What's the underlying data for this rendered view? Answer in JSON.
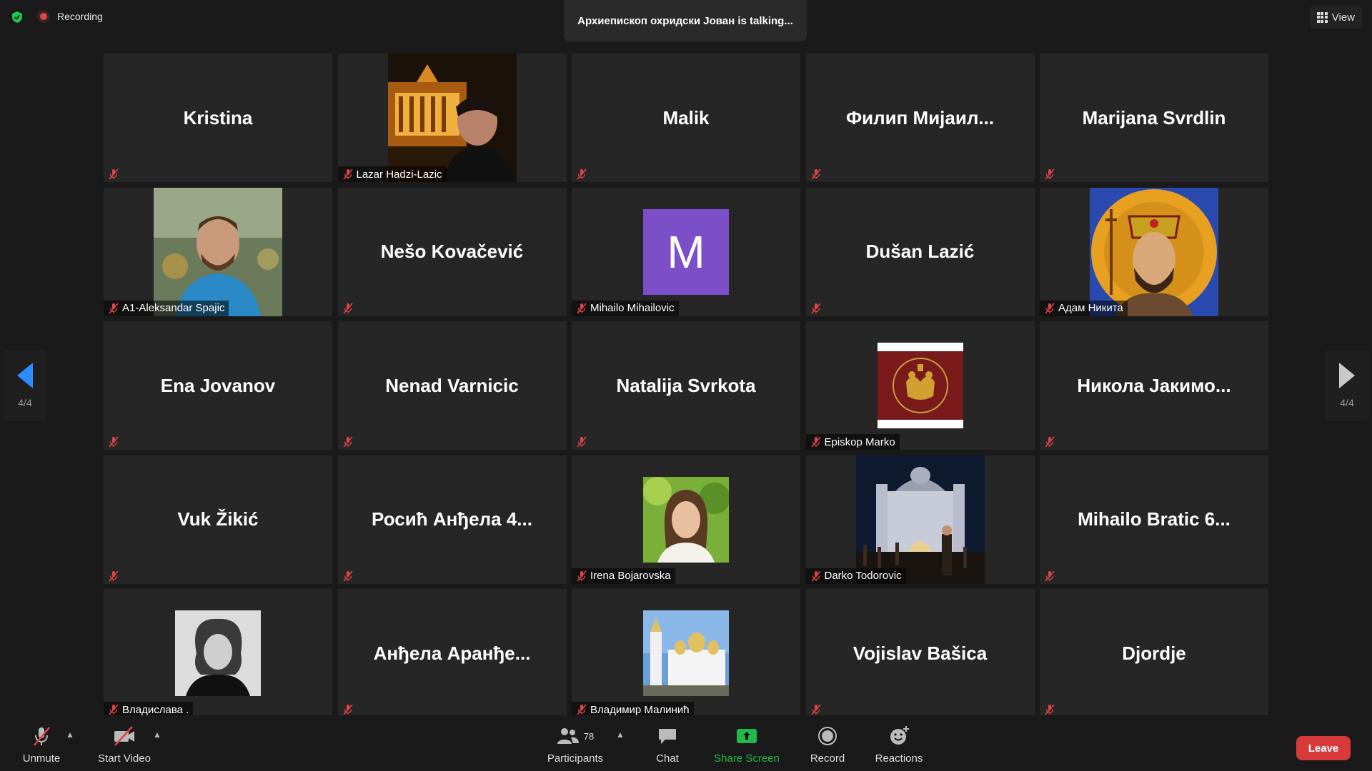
{
  "topbar": {
    "recording_label": "Recording",
    "talking_text": "Архиепископ охридски Јован is talking...",
    "view_label": "View"
  },
  "nav": {
    "left_page": "4/4",
    "right_page": "4/4"
  },
  "tiles": [
    {
      "name": "Kristina",
      "type": "name"
    },
    {
      "name": "Lazar Hadzi-Lazic",
      "type": "video",
      "photo": "city-night-portrait"
    },
    {
      "name": "Malik",
      "type": "name"
    },
    {
      "name": "Филип Мијаил...",
      "type": "name"
    },
    {
      "name": "Marijana Svrdlin",
      "type": "name"
    },
    {
      "name": "A1-Aleksandar Spajic",
      "type": "video",
      "photo": "man-blue-shirt"
    },
    {
      "name": "Nešo Kovačević",
      "type": "name"
    },
    {
      "name": "Mihailo Mihailovic",
      "type": "avatar",
      "letter": "M",
      "color": "#7c4fc9"
    },
    {
      "name": "Dušan Lazić",
      "type": "name"
    },
    {
      "name": "Адам Никита",
      "type": "video",
      "photo": "icon-saint"
    },
    {
      "name": "Ena Jovanov",
      "type": "name"
    },
    {
      "name": "Nenad Varnicic",
      "type": "name"
    },
    {
      "name": "Natalija Svrkota",
      "type": "name"
    },
    {
      "name": "Episkop Marko",
      "type": "square",
      "photo": "red-emblem"
    },
    {
      "name": "Никола Јакимо...",
      "type": "name"
    },
    {
      "name": "Vuk Žikić",
      "type": "name"
    },
    {
      "name": "Росић Анђела 4...",
      "type": "name"
    },
    {
      "name": "Irena Bojarovska",
      "type": "square",
      "photo": "woman-green"
    },
    {
      "name": "Darko Todorovic",
      "type": "video",
      "photo": "church-night"
    },
    {
      "name": "Mihailo Bratic 6...",
      "type": "name"
    },
    {
      "name": "Владислава .",
      "type": "square",
      "photo": "woman-bw"
    },
    {
      "name": "Анђела Аранђе...",
      "type": "name"
    },
    {
      "name": "Владимир Малинић",
      "type": "square",
      "photo": "cathedral-white"
    },
    {
      "name": "Vojislav Bašica",
      "type": "name"
    },
    {
      "name": "Djordje",
      "type": "name"
    }
  ],
  "toolbar": {
    "unmute": "Unmute",
    "start_video": "Start Video",
    "participants": "Participants",
    "participants_count": "78",
    "chat": "Chat",
    "share_screen": "Share Screen",
    "record": "Record",
    "reactions": "Reactions",
    "leave": "Leave"
  },
  "colors": {
    "accent": "#2d8cff",
    "share": "#22b84a",
    "leave": "#d73a3a",
    "mic_off": "#e04444"
  }
}
